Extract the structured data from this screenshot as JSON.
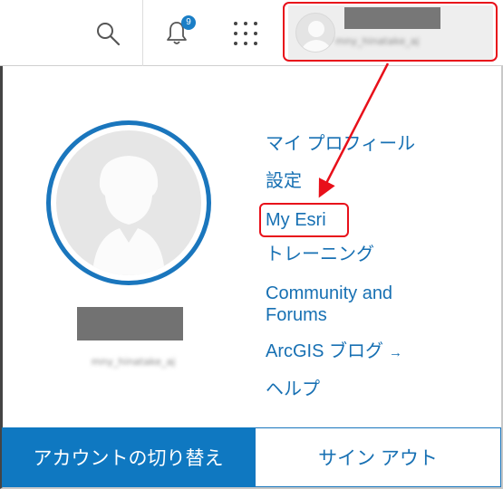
{
  "header": {
    "notification_count": "9",
    "icons": [
      "search-icon",
      "bell-icon",
      "apps-grid-icon",
      "user-avatar-icon"
    ],
    "user_handle_blurred": "mny_hinatake_aj"
  },
  "profile": {
    "handle_blurred": "mny_hinatake_aj"
  },
  "menu": {
    "items": [
      {
        "label": "マイ プロフィール"
      },
      {
        "label": "設定"
      },
      {
        "label": "My Esri"
      },
      {
        "label": "トレーニング"
      },
      {
        "label": "Community and Forums",
        "line1": "Community and",
        "line2": "Forums"
      },
      {
        "label": "ArcGIS ブログ",
        "external_icon": "→"
      },
      {
        "label": "ヘルプ"
      }
    ]
  },
  "footer": {
    "switch_account_label": "アカウントの切り替え",
    "sign_out_label": "サイン アウト"
  },
  "colors": {
    "accent": "#1a76bd",
    "link": "#1770b3",
    "annotation": "#e8101a"
  }
}
